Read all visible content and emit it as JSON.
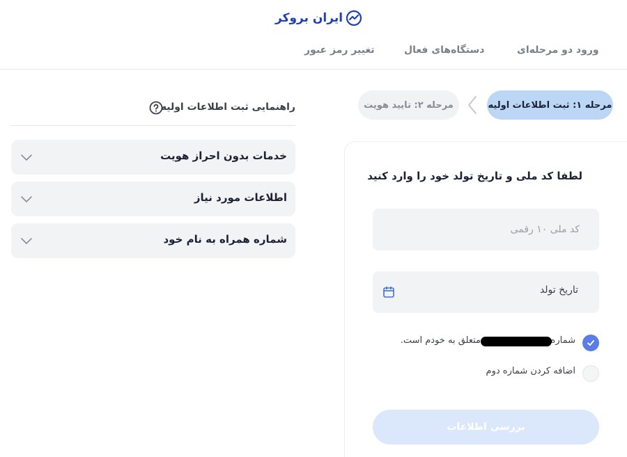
{
  "brand": {
    "name": "ایران بروکر",
    "icon": "ibroker-logo-icon",
    "color": "#1d3fbb"
  },
  "nav": {
    "tabs": [
      {
        "label": "ورود دو مرحله‌ای"
      },
      {
        "label": "دستگاه‌های فعال"
      },
      {
        "label": "تغییر رمز عبور"
      }
    ]
  },
  "steps": [
    {
      "label": "مرحله ۱: ثبت اطلاعات اولیه",
      "state": "active"
    },
    {
      "label": "مرحله ۲: تایید هویت",
      "state": "inactive"
    }
  ],
  "form": {
    "title": "لطفا کد ملی و تاریخ تولد خود را وارد کنید",
    "national_id": {
      "placeholder": "کد ملی ۱۰ رقمی",
      "value": ""
    },
    "birth_date": {
      "label": "تاریخ تولد",
      "icon": "calendar-icon"
    },
    "options": {
      "own_number": {
        "prefix": "شماره",
        "suffix": "متعلق به خودم است.",
        "checked": true
      },
      "second_number": {
        "label": "اضافه کردن شماره دوم",
        "checked": false
      }
    },
    "submit_label": "بررسی اطلاعات"
  },
  "guide": {
    "title": "راهنمایی ثبت اطلاعات اولیه",
    "icon": "help-circle-icon",
    "items": [
      {
        "label": "خدمات بدون احراز هویت"
      },
      {
        "label": "اطلاعات مورد نیاز"
      },
      {
        "label": "شماره همراه به نام خود"
      }
    ]
  },
  "colors": {
    "accent": "#5b7be6",
    "step_active_bg": "#bcd6f6",
    "submit_disabled_bg": "#dbe8fb"
  }
}
